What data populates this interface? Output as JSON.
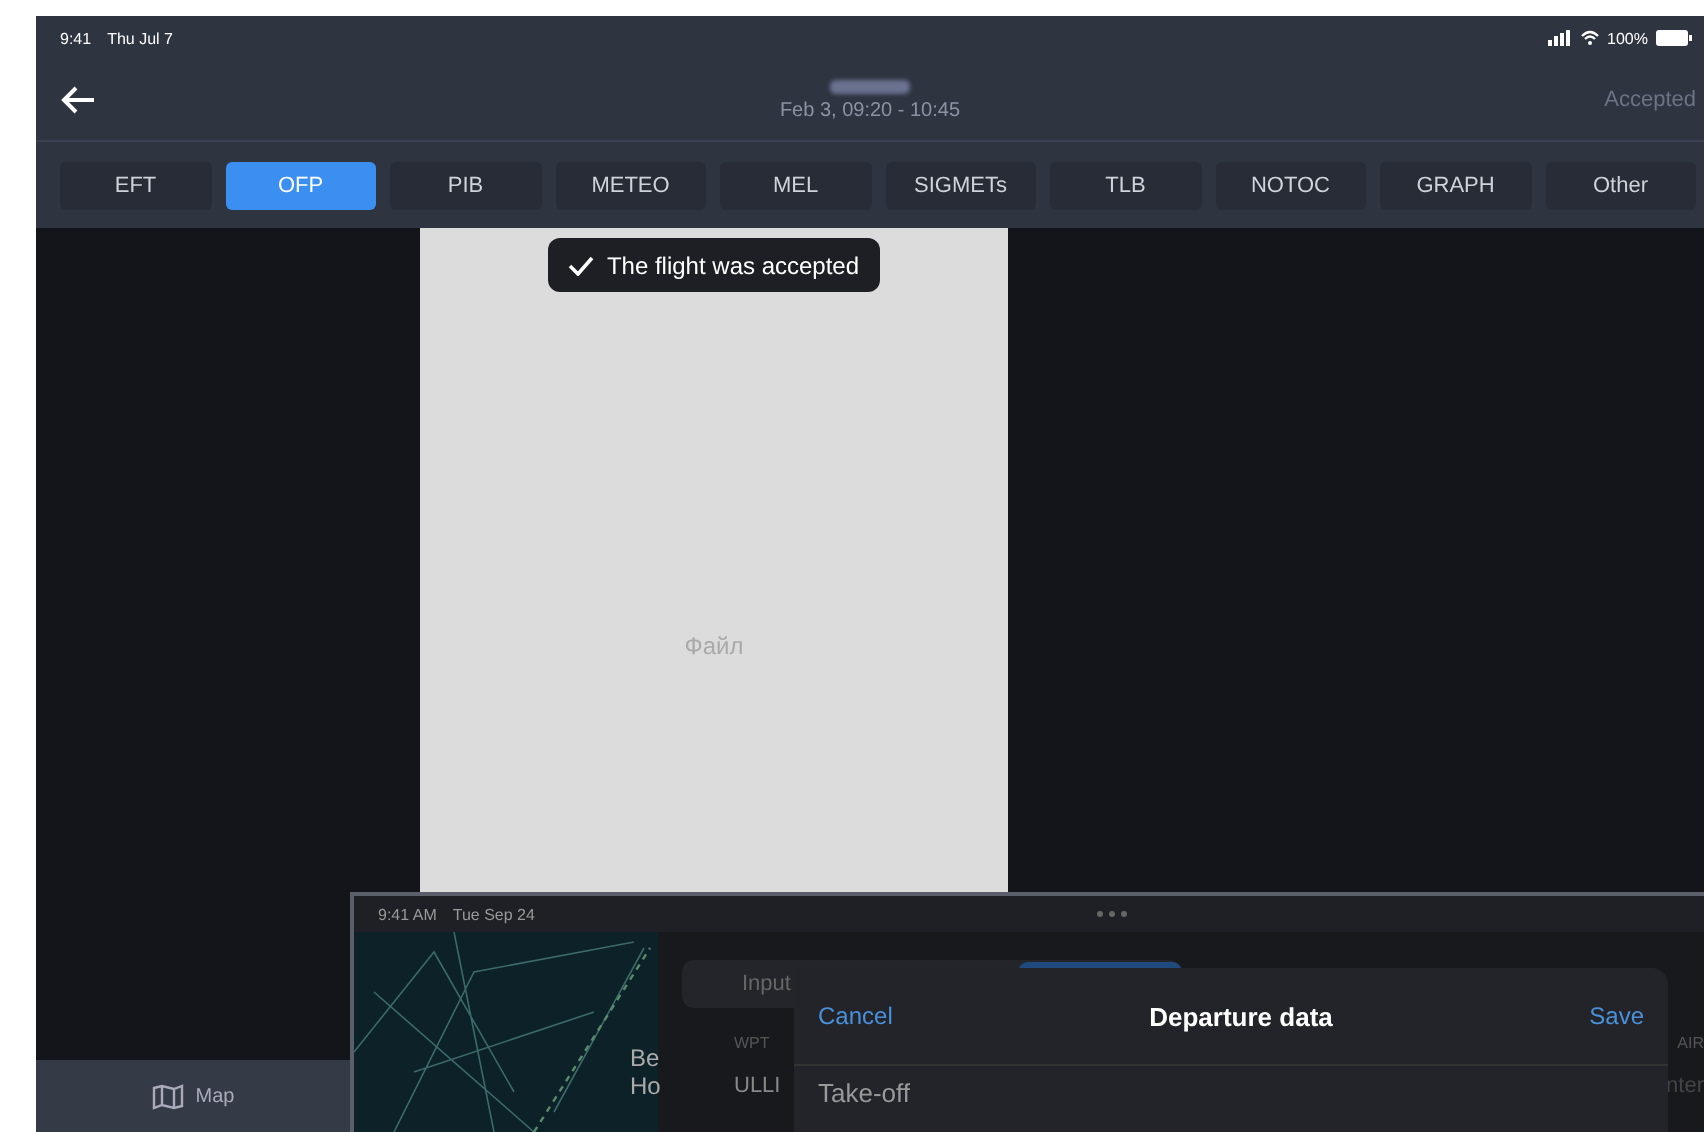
{
  "status_bar": {
    "time": "9:41",
    "date": "Thu Jul 7",
    "battery": "100%"
  },
  "header": {
    "subtitle": "Feb 3, 09:20 - 10:45",
    "status": "Accepted"
  },
  "tabs": [
    {
      "label": "EFT",
      "selected": false
    },
    {
      "label": "OFP",
      "selected": true
    },
    {
      "label": "PIB",
      "selected": false
    },
    {
      "label": "METEO",
      "selected": false
    },
    {
      "label": "MEL",
      "selected": false
    },
    {
      "label": "SIGMETs",
      "selected": false
    },
    {
      "label": "TLB",
      "selected": false
    },
    {
      "label": "NOTOC",
      "selected": false
    },
    {
      "label": "GRAPH",
      "selected": false
    },
    {
      "label": "Other",
      "selected": false
    }
  ],
  "toast": "The flight was accepted",
  "document": {
    "placeholder_text": "Файл"
  },
  "bottom_bar": {
    "items": [
      {
        "label": "Map"
      }
    ]
  },
  "inset_screen": {
    "status_time": "9:41 AM",
    "status_date": "Tue Sep 24",
    "map_labels": [
      "Be",
      "Ho"
    ],
    "segment": "Input",
    "column_header": "WPT",
    "row_value": "ULLI",
    "right_header": "AIR",
    "right_value": "nter",
    "modal": {
      "cancel": "Cancel",
      "title": "Departure data",
      "save": "Save",
      "section": "Take-off"
    }
  }
}
